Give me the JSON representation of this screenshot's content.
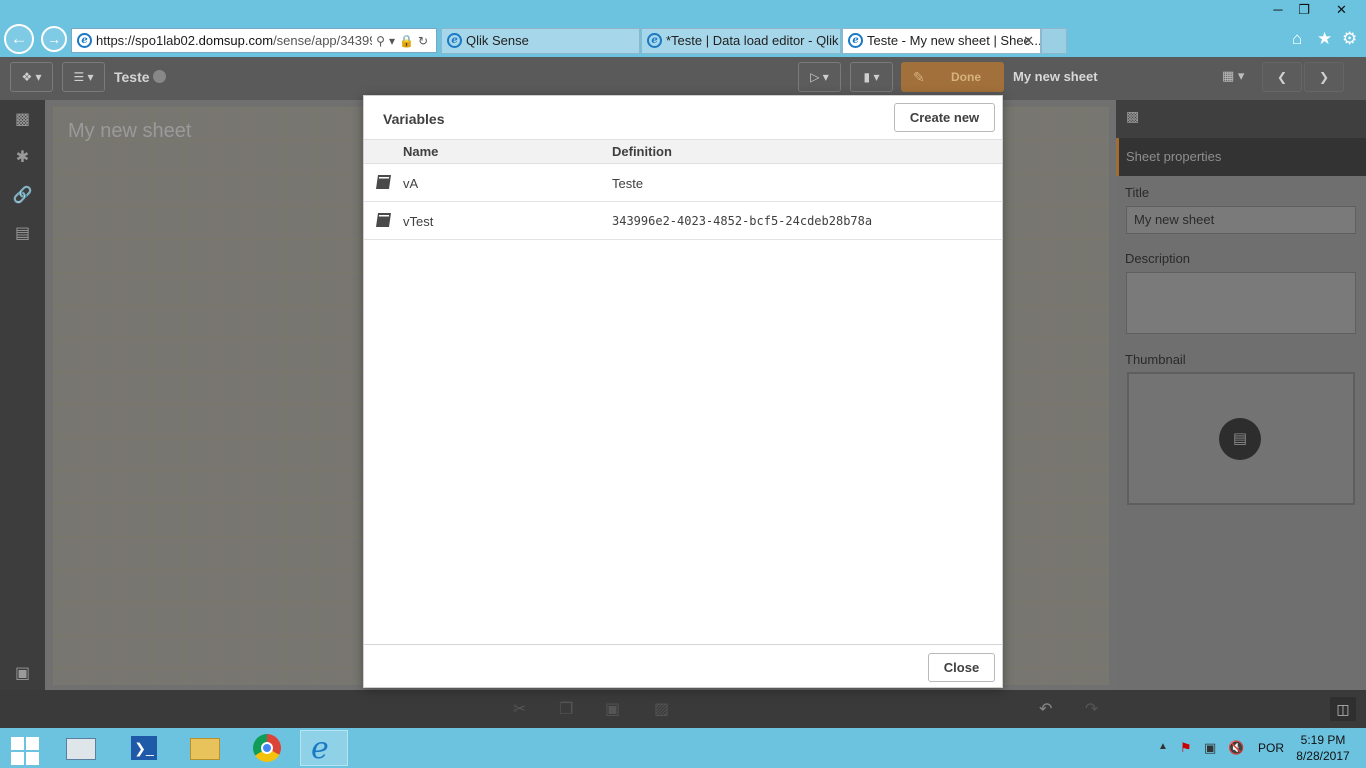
{
  "browser": {
    "url_scheme": "https://spo1lab02.",
    "url_host": "domsup.com",
    "url_path": "/sense/app/343996",
    "tabs": [
      {
        "label": "Qlik Sense",
        "active": false
      },
      {
        "label": "*Teste | Data load editor - Qlik ...",
        "active": false
      },
      {
        "label": "Teste - My new sheet | Shee...",
        "active": true
      }
    ]
  },
  "toolbar": {
    "app_name": "Teste",
    "done_label": "Done",
    "sheet_title": "My new sheet"
  },
  "canvas": {
    "sheet_name": "My new sheet"
  },
  "properties": {
    "header": "Sheet properties",
    "title_label": "Title",
    "title_value": "My new sheet",
    "description_label": "Description",
    "description_value": "",
    "thumbnail_label": "Thumbnail"
  },
  "dialog": {
    "title": "Variables",
    "create_new_label": "Create new",
    "columns": {
      "name": "Name",
      "definition": "Definition"
    },
    "variables": [
      {
        "name": "vA",
        "definition": "Teste"
      },
      {
        "name": "vTest",
        "definition": "343996e2-4023-4852-bcf5-24cdeb28b78a"
      }
    ],
    "close_label": "Close"
  },
  "taskbar": {
    "language": "POR",
    "time": "5:19 PM",
    "date": "8/28/2017"
  },
  "colors": {
    "browser_chrome": "#6cc3e0",
    "qlik_toolbar": "#5a5a5a",
    "done_button": "#a2703a",
    "dialog_bg": "#ffffff"
  }
}
